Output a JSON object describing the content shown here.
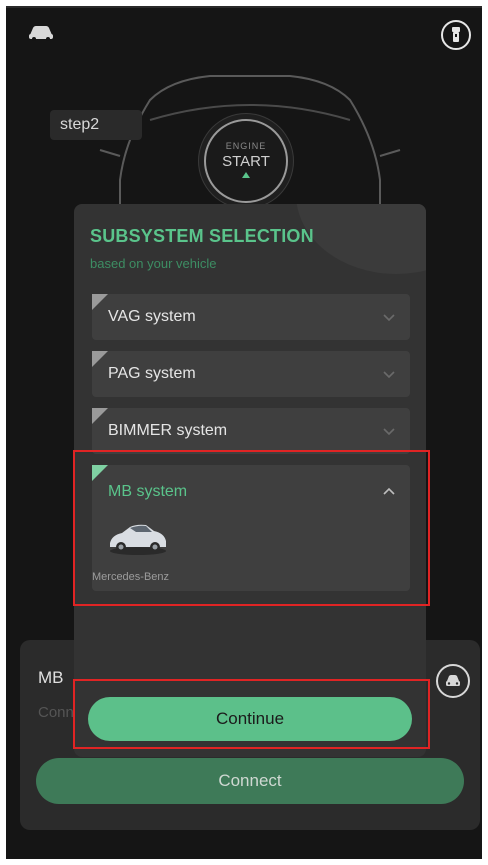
{
  "header": {
    "left_icon": "car-icon",
    "right_icon": "flashlight-icon"
  },
  "step": {
    "label": "step2"
  },
  "engine": {
    "small_label": "ENGINE",
    "big_label": "START"
  },
  "modal": {
    "title": "SUBSYSTEM SELECTION",
    "subtitle": "based on your vehicle",
    "systems": [
      {
        "label": "VAG system",
        "expanded": false
      },
      {
        "label": "PAG system",
        "expanded": false
      },
      {
        "label": "BIMMER system",
        "expanded": false
      },
      {
        "label": "MB system",
        "expanded": true,
        "brand": "Mercedes-Benz"
      }
    ],
    "continue_label": "Continue"
  },
  "bottom_card": {
    "title": "MB",
    "subtitle": "Conn",
    "icon": "car-front-icon",
    "connect_label": "Connect"
  },
  "colors": {
    "accent": "#5cc08a",
    "background": "#151515",
    "highlight": "#e02424"
  }
}
